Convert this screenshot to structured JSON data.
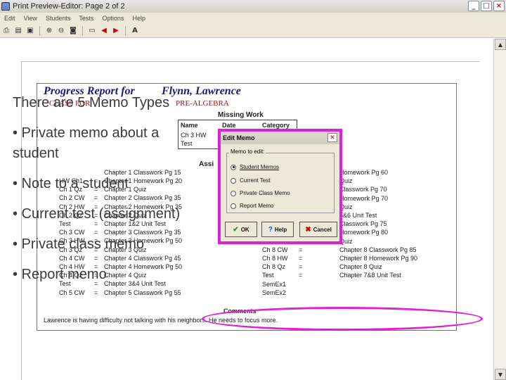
{
  "window": {
    "title": "Print Preview-Editor:  Page 2 of 2",
    "controls": [
      "_",
      "□",
      "×"
    ]
  },
  "menu": [
    "Edit",
    "View",
    "Students",
    "Tests",
    "Options",
    "Help"
  ],
  "toolbar_icons": [
    "print-icon",
    "printer-setup-icon",
    "save-icon",
    "zoom-in-icon",
    "zoom-out-icon",
    "zoom-page-icon",
    "page-icon",
    "prev-page-icon",
    "next-page-icon",
    "font-icon"
  ],
  "report": {
    "title_left": "Progress Report for",
    "title_name": "Flynn, Lawrence",
    "subject": "PRE-ALGEBRA",
    "section_header_left": "CLASS FOR",
    "missing_work": {
      "header": "Missing Work",
      "columns": [
        "Name",
        "Date",
        "Category"
      ],
      "rows": [
        [
          "Ch 3 HW",
          "",
          ""
        ],
        [
          "Test",
          "",
          ""
        ]
      ]
    },
    "assign_label": "Assi",
    "left_items": [
      [
        "HW Ch1",
        "=",
        "Chapter 1 Homework Pg 20"
      ],
      [
        "Ch 1 Qz",
        "=",
        "Chapter 1 Quiz"
      ],
      [
        "Ch 2 CW",
        "=",
        "Chapter 2 Classwork Pg 35"
      ],
      [
        "Ch 2 HW",
        "=",
        "Chapter 2 Homework Pg 35"
      ],
      [
        "Ch 2 Qz",
        "=",
        "Chapter 2 Quiz"
      ],
      [
        "Test",
        "=",
        "Chapter 1&2 Unit Test"
      ],
      [
        "Ch 3 CW",
        "=",
        "Chapter 3 Classwork Pg 35"
      ],
      [
        "Ch 3 HW",
        "=",
        "Chapter 3 Homework Pg 50"
      ],
      [
        "Ch 3 Qz",
        "=",
        "Chapter 3 Quiz"
      ],
      [
        "Ch 4 CW",
        "=",
        "Chapter 4 Classwork Pg 45"
      ],
      [
        "Ch 4 HW",
        "=",
        "Chapter 4 Homework Pg 50"
      ],
      [
        "Ch 4 Qz",
        "=",
        "Chapter 4 Quiz"
      ],
      [
        "Test",
        "=",
        "Chapter 3&4 Unit Test"
      ],
      [
        "Ch 5 CW",
        "=",
        "Chapter 5 Classwork Pg 55"
      ]
    ],
    "left_first": "Chapter 1 Classwork Pg 15",
    "right_items": [
      [
        "",
        "",
        "Homework Pg 60"
      ],
      [
        "",
        "",
        "Quiz"
      ],
      [
        "",
        "",
        "Classwork Pg 70"
      ],
      [
        "",
        "",
        "Homework Pg 70"
      ],
      [
        "",
        "",
        "Quiz"
      ],
      [
        "",
        "",
        "5&6 Unit Test"
      ],
      [
        "",
        "",
        "Classwork Pg 75"
      ],
      [
        "",
        "",
        "Homework Pg 80"
      ],
      [
        "",
        "",
        "Quiz"
      ],
      [
        "Ch 8 CW",
        "=",
        "Chapter 8 Classwork Pg 85"
      ],
      [
        "Ch 8 HW",
        "=",
        "Chapter 8 Homework Pg 90"
      ],
      [
        "Ch 8 Qz",
        "=",
        "Chapter 8 Quiz"
      ],
      [
        "Test",
        "=",
        "Chapter 7&8 Unit Test"
      ],
      [
        "SemEx1",
        "",
        ""
      ],
      [
        "SemEx2",
        "",
        ""
      ]
    ],
    "comments_label": "Comments",
    "comments_text": "Lawrence is having difficulty not talking with his neighbors.  He needs to focus more."
  },
  "dialog": {
    "title": "Edit Memo",
    "group_label": "Memo to edit:",
    "options": [
      {
        "label": "Student Memos",
        "selected": true
      },
      {
        "label": "Current Test",
        "selected": false
      },
      {
        "label": "Private Class Memo",
        "selected": false
      },
      {
        "label": "Report Memo",
        "selected": false
      }
    ],
    "buttons": {
      "ok": "OK",
      "help": "Help",
      "cancel": "Cancel"
    }
  },
  "slide": {
    "heading": "There are 5 Memo Types",
    "bullets": [
      "• Private memo about a student",
      "• Note to a student",
      "• Current test (assignment)",
      "• Private class memo",
      "• Report memo"
    ]
  },
  "colors": {
    "highlight": "#e020d8",
    "title_blue": "#1a1a7a",
    "subject_red": "#a11"
  }
}
